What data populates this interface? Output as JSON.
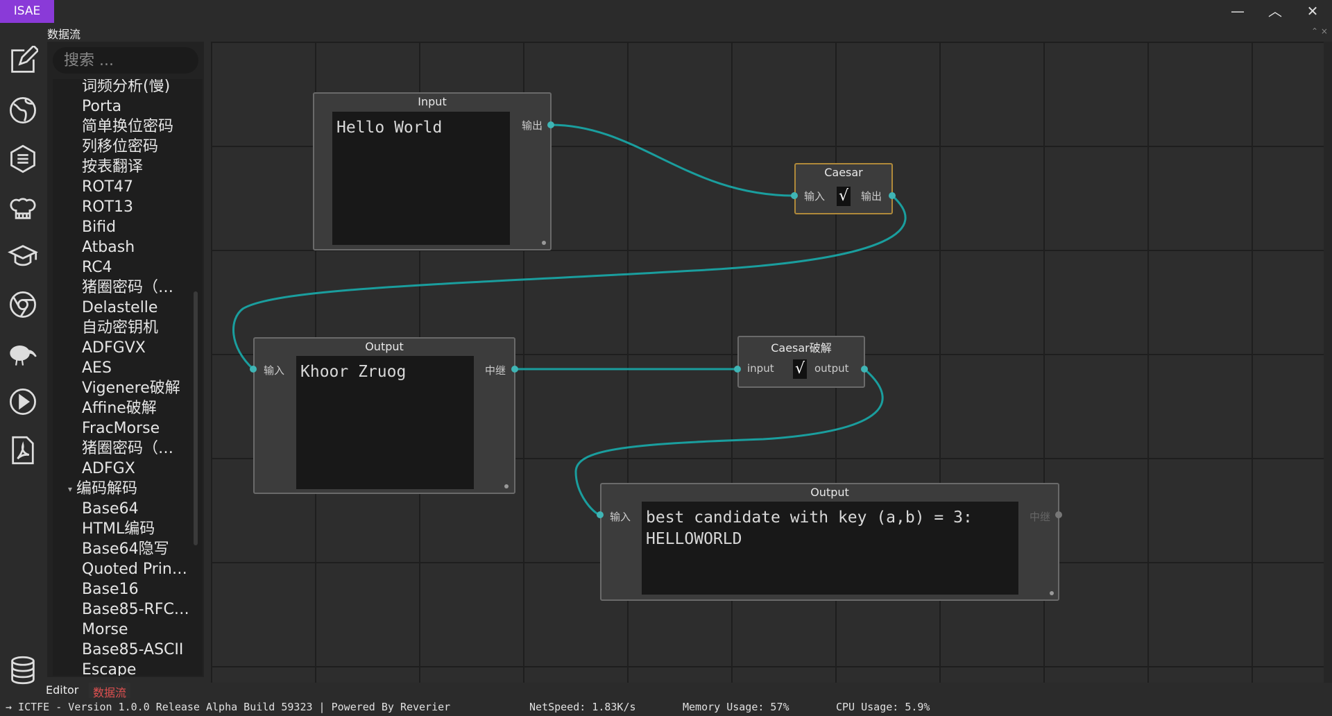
{
  "app": {
    "badge": "ISAE"
  },
  "window_controls": {
    "minimize": "—",
    "maximize": "︿",
    "close": "✕"
  },
  "iconbar": [
    "edit-icon",
    "globe-icon",
    "menu-list-icon",
    "chef-hat-icon",
    "graduation-cap-icon",
    "chrome-icon",
    "kiwi-bird-icon",
    "play-circle-icon",
    "pdf-icon",
    "database-icon"
  ],
  "panel": {
    "title": "数据流",
    "corner": "⌃ ×"
  },
  "search": {
    "placeholder": "搜索 ..."
  },
  "tree": {
    "items": [
      "词频分析(慢)",
      "Porta",
      "简单换位密码",
      "列移位密码",
      "按表翻译",
      "ROT47",
      "ROT13",
      "Bifid",
      "Atbash",
      "RC4",
      "猪圈密码（…",
      "Delastelle",
      "自动密钥机",
      "ADFGVX",
      "AES",
      "Vigenere破解",
      "Affine破解",
      "FracMorse",
      "猪圈密码（…",
      "ADFGX"
    ],
    "group": "编码解码",
    "group_items": [
      "Base64",
      "HTML编码",
      "Base64隐写",
      "Quoted Prin…",
      "Base16",
      "Base85-RFC…",
      "Morse",
      "Base85-ASCII",
      "Escape"
    ]
  },
  "nodes": {
    "input": {
      "title": "Input",
      "text": "Hello World",
      "out_label": "输出"
    },
    "caesar": {
      "title": "Caesar",
      "in_label": "输入",
      "check": "√",
      "out_label": "输出"
    },
    "output1": {
      "title": "Output",
      "in_label": "输入",
      "text": "Khoor Zruog",
      "relay_label": "中继"
    },
    "caesar_crack": {
      "title": "Caesar破解",
      "in_label": "input",
      "check": "√",
      "out_label": "output"
    },
    "output2": {
      "title": "Output",
      "in_label": "输入",
      "text": "best candidate with key (a,b) = 3:\nHELLOWORLD",
      "relay_label": "中继"
    }
  },
  "colors": {
    "link": "#1a9e9e",
    "port": "#3fb5b5",
    "badge": "#8a3ad8",
    "active_tab": "#e05050"
  },
  "tabs": {
    "editor": "Editor",
    "dataflow": "数据流"
  },
  "status": {
    "version": "→ ICTFE - Version 1.0.0 Release Alpha Build 59323 | Powered By Reverier",
    "netspeed": "NetSpeed: 1.83K/s",
    "memory": "Memory Usage: 57%",
    "cpu": "CPU Usage: 5.9%"
  }
}
